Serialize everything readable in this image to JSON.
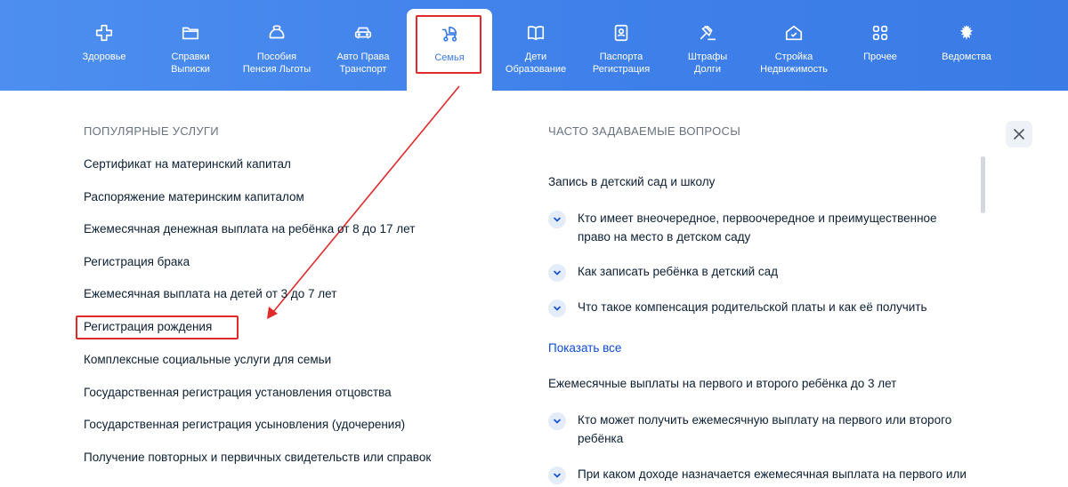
{
  "nav": {
    "items": [
      {
        "label": "Здоровье",
        "icon": "plus-icon"
      },
      {
        "label": "Справки\nВыписки",
        "icon": "folder-icon"
      },
      {
        "label": "Пособия\nПенсия Льготы",
        "icon": "wallet-icon"
      },
      {
        "label": "Авто Права\nТранспорт",
        "icon": "car-icon"
      },
      {
        "label": "Семья",
        "icon": "stroller-icon"
      },
      {
        "label": "Дети\nОбразование",
        "icon": "book-icon"
      },
      {
        "label": "Паспорта\nРегистрация",
        "icon": "passport-icon"
      },
      {
        "label": "Штрафы\nДолги",
        "icon": "gavel-icon"
      },
      {
        "label": "Стройка\nНедвижимость",
        "icon": "house-icon"
      },
      {
        "label": "Прочее",
        "icon": "grid-icon"
      },
      {
        "label": "Ведомства",
        "icon": "emblem-icon"
      }
    ],
    "active_index": 4
  },
  "popular": {
    "title": "ПОПУЛЯРНЫЕ УСЛУГИ",
    "items": [
      "Сертификат на материнский капитал",
      "Распоряжение материнским капиталом",
      "Ежемесячная денежная выплата на ребёнка от 8 до 17 лет",
      "Регистрация брака",
      "Ежемесячная выплата на детей от 3 до 7 лет",
      "Регистрация рождения",
      "Комплексные социальные услуги для семьи",
      "Государственная регистрация установления отцовства",
      "Государственная регистрация усыновления (удочерения)",
      "Получение повторных и первичных свидетельств или справок"
    ]
  },
  "faq": {
    "title": "ЧАСТО ЗАДАВАЕМЫЕ ВОПРОСЫ",
    "groups": [
      {
        "title": "Запись в детский сад и школу",
        "questions": [
          "Кто имеет внеочередное, первоочередное и преимущественное право на место в детском саду",
          "Как записать ребёнка в детский сад",
          "Что такое компенсация родительской платы и как её получить"
        ],
        "show_all": "Показать все"
      },
      {
        "title": "Ежемесячные выплаты на первого и второго ребёнка до 3 лет",
        "questions": [
          "Кто может получить ежемесячную выплату на первого или второго ребёнка",
          "При каком доходе назначается ежемесячная выплата на первого или"
        ]
      }
    ]
  },
  "colors": {
    "nav_bg": "#3f80ea",
    "link": "#0d4cd3",
    "highlight": "#e02a2a",
    "text": "#0b1f33",
    "muted": "#66727f"
  }
}
